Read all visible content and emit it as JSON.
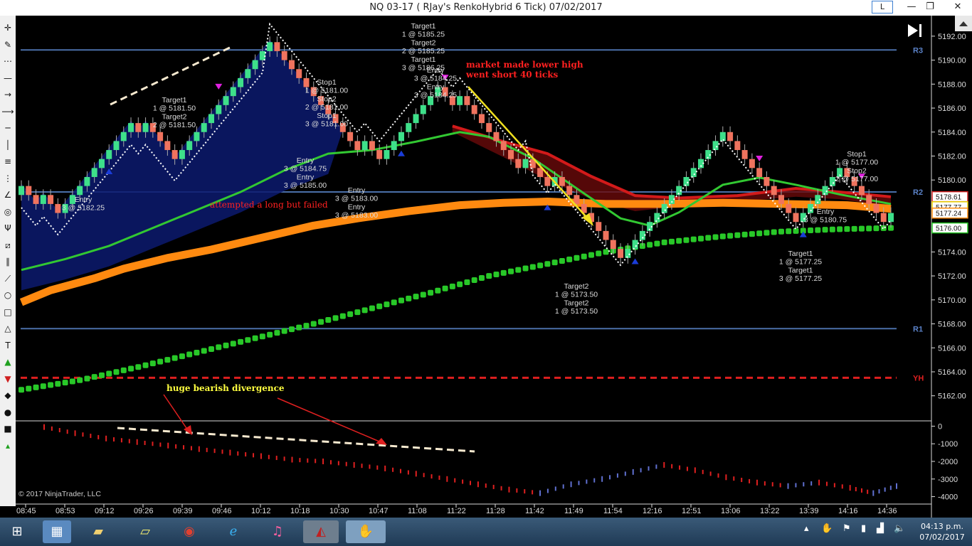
{
  "window": {
    "title": "NQ 03-17 ( RJay's RenkoHybrid  6 Tick)  07/02/2017",
    "l_button": "L",
    "minimize": "—",
    "restore": "❐",
    "close": "✕"
  },
  "toolbar": {
    "icons": [
      "crosshair-icon",
      "pencil-icon",
      "dots-icon",
      "line-icon",
      "ray-icon",
      "arrow-line-icon",
      "horizontal-line-icon",
      "vertical-line-icon",
      "channel-icon",
      "fib-icon",
      "gann-icon",
      "circle-target-icon",
      "pitchfork-icon",
      "regression-icon",
      "parallel-icon",
      "trend-icon",
      "ellipse-icon",
      "rectangle-icon",
      "triangle-icon",
      "text-icon",
      "arrow-up-icon",
      "arrow-down-icon",
      "diamond-icon",
      "dot-icon",
      "square-icon",
      "triangle-up-icon"
    ]
  },
  "chart_data": {
    "type": "candlestick",
    "price_axis": {
      "min": 5160.5,
      "max": 5193.0,
      "ticks": [
        "5192.00",
        "5190.00",
        "5188.00",
        "5186.00",
        "5184.00",
        "5182.00",
        "5180.00",
        "5178.00",
        "5176.00",
        "5174.00",
        "5172.00",
        "5170.00",
        "5168.00",
        "5166.00",
        "5164.00",
        "5162.00"
      ]
    },
    "price_boxes": [
      {
        "label": "5178.61",
        "value": 5178.61,
        "color": "#d02020"
      },
      {
        "label": "5177.77",
        "value": 5177.77,
        "color": "#e8d000"
      },
      {
        "label": "5177.24",
        "value": 5177.24,
        "color": "#ff8c10"
      },
      {
        "label": "5176.00",
        "value": 5176.0,
        "color": "#20c020"
      }
    ],
    "time_labels": [
      "08:45",
      "08:53",
      "09:12",
      "09:26",
      "09:39",
      "09:46",
      "10:12",
      "10:18",
      "10:30",
      "10:47",
      "11:08",
      "11:22",
      "11:28",
      "11:42",
      "11:49",
      "11:54",
      "12:16",
      "12:51",
      "13:06",
      "13:22",
      "13:39",
      "14:16",
      "14:36"
    ],
    "pivot_levels": [
      {
        "name": "R3",
        "value": 5190.85,
        "color": "#4a6fa8",
        "style": "solid"
      },
      {
        "name": "R2",
        "value": 5179.0,
        "color": "#4a6fa8",
        "style": "solid"
      },
      {
        "name": "R1",
        "value": 5167.6,
        "color": "#4a6fa8",
        "style": "solid"
      },
      {
        "name": "YH",
        "value": 5163.5,
        "color": "#dd1f1f",
        "style": "dashed"
      }
    ],
    "candles": [
      5179.5,
      5178.75,
      5178.0,
      5178.75,
      5178.0,
      5177.25,
      5178.0,
      5178.75,
      5179.5,
      5180.25,
      5181.0,
      5181.75,
      5182.5,
      5183.25,
      5184.0,
      5184.75,
      5184.0,
      5184.75,
      5184.0,
      5183.25,
      5182.5,
      5181.75,
      5182.5,
      5183.25,
      5184.0,
      5184.75,
      5185.5,
      5186.25,
      5187.0,
      5187.75,
      5188.5,
      5189.25,
      5190.0,
      5190.75,
      5191.5,
      5190.75,
      5190.0,
      5189.25,
      5188.5,
      5187.75,
      5187.0,
      5186.25,
      5185.5,
      5184.75,
      5184.0,
      5183.25,
      5182.5,
      5183.25,
      5182.5,
      5181.75,
      5182.5,
      5183.25,
      5184.0,
      5184.75,
      5185.5,
      5186.25,
      5187.0,
      5187.75,
      5187.0,
      5186.25,
      5187.0,
      5186.25,
      5185.5,
      5184.75,
      5184.0,
      5183.25,
      5182.5,
      5181.75,
      5181.0,
      5181.75,
      5181.0,
      5180.25,
      5179.5,
      5180.25,
      5179.5,
      5178.75,
      5178.0,
      5177.25,
      5176.5,
      5175.75,
      5175.0,
      5174.25,
      5173.5,
      5174.25,
      5175.0,
      5175.75,
      5176.5,
      5177.25,
      5178.0,
      5178.75,
      5179.5,
      5180.25,
      5181.0,
      5181.75,
      5182.5,
      5183.25,
      5184.0,
      5183.25,
      5182.5,
      5181.75,
      5181.0,
      5180.25,
      5179.5,
      5178.75,
      5178.0,
      5177.25,
      5176.5,
      5177.25,
      5178.0,
      5178.75,
      5179.5,
      5180.25,
      5181.0,
      5180.25,
      5179.5,
      5178.75,
      5178.0,
      5177.25,
      5176.5,
      5177.25
    ],
    "indicators": {
      "orange_line": [
        [
          0,
          5169.8
        ],
        [
          4,
          5170.8
        ],
        [
          10,
          5171.8
        ],
        [
          14,
          5172.6
        ],
        [
          20,
          5173.5
        ],
        [
          26,
          5174.2
        ],
        [
          33,
          5175.2
        ],
        [
          40,
          5176.2
        ],
        [
          46,
          5176.8
        ],
        [
          53,
          5177.4
        ],
        [
          60,
          5177.9
        ],
        [
          66,
          5178.1
        ],
        [
          72,
          5178.2
        ],
        [
          80,
          5178.0
        ],
        [
          88,
          5178.0
        ],
        [
          96,
          5178.1
        ],
        [
          104,
          5178.0
        ],
        [
          113,
          5177.9
        ],
        [
          119,
          5177.6
        ]
      ],
      "green_dots": [
        [
          0,
          5162.5
        ],
        [
          8,
          5163.3
        ],
        [
          16,
          5164.4
        ],
        [
          24,
          5165.6
        ],
        [
          32,
          5166.8
        ],
        [
          40,
          5168.0
        ],
        [
          48,
          5169.3
        ],
        [
          56,
          5170.6
        ],
        [
          64,
          5172.0
        ],
        [
          72,
          5173.0
        ],
        [
          80,
          5174.0
        ],
        [
          88,
          5174.8
        ],
        [
          96,
          5175.3
        ],
        [
          104,
          5175.7
        ],
        [
          112,
          5175.9
        ],
        [
          119,
          5176.0
        ]
      ],
      "green_line": [
        [
          0,
          5172.5
        ],
        [
          6,
          5173.4
        ],
        [
          12,
          5174.5
        ],
        [
          18,
          5176.0
        ],
        [
          24,
          5177.5
        ],
        [
          30,
          5179.0
        ],
        [
          36,
          5180.8
        ],
        [
          42,
          5182.2
        ],
        [
          48,
          5182.5
        ],
        [
          54,
          5183.2
        ],
        [
          60,
          5184.0
        ],
        [
          64,
          5183.6
        ],
        [
          70,
          5181.8
        ],
        [
          76,
          5179.3
        ],
        [
          82,
          5176.8
        ],
        [
          86,
          5176.2
        ],
        [
          90,
          5177.3
        ],
        [
          96,
          5179.6
        ],
        [
          101,
          5180.2
        ],
        [
          106,
          5179.6
        ],
        [
          112,
          5178.8
        ],
        [
          119,
          5178.0
        ]
      ],
      "red_band_top": [
        [
          59,
          5184.5
        ],
        [
          66,
          5183.2
        ],
        [
          72,
          5182.2
        ],
        [
          78,
          5180.3
        ],
        [
          84,
          5178.7
        ],
        [
          90,
          5178.5
        ],
        [
          98,
          5178.7
        ],
        [
          106,
          5179.3
        ],
        [
          112,
          5179.0
        ],
        [
          119,
          5178.6
        ]
      ],
      "red_band_bottom": [
        [
          59,
          5184.0
        ],
        [
          66,
          5181.9
        ],
        [
          72,
          5180.0
        ],
        [
          78,
          5178.4
        ],
        [
          84,
          5177.4
        ],
        [
          90,
          5177.8
        ],
        [
          98,
          5178.2
        ],
        [
          106,
          5178.6
        ],
        [
          112,
          5178.4
        ],
        [
          119,
          5177.8
        ]
      ]
    },
    "annotations": [
      {
        "text": "market made lower high",
        "color": "#ff2020",
        "bold": true
      },
      {
        "text": "went short 40 ticks",
        "color": "#ff2020",
        "bold": true
      },
      {
        "text": "attempted a long but failed",
        "color": "#ff2020",
        "bold": false
      },
      {
        "text": "huge bearish divergence",
        "color": "#ffff40",
        "bold": true
      }
    ],
    "trade_labels": [
      {
        "lines": [
          "Target1",
          "1 @ 5181.50",
          "Target2",
          "2 @ 5181.50"
        ]
      },
      {
        "lines": [
          "Entry",
          "3 @ 5182.25"
        ]
      },
      {
        "lines": [
          "Target1",
          "1 @ 5185.25",
          "Target2",
          "2 @ 5185.25",
          "Target1",
          "3 @ 5186.25"
        ]
      },
      {
        "lines": [
          "Stop1",
          "1 @ 5181.00",
          "Stop2",
          "2 @ 5181.00",
          "Stop1",
          "3 @ 5181.00"
        ]
      },
      {
        "lines": [
          "Entry",
          "3 @ 5184.25",
          "Entry",
          "3 @ 5184.25"
        ]
      },
      {
        "lines": [
          "Entry",
          "3 @ 5184.75",
          "Entry",
          "3 @ 5185.00"
        ]
      },
      {
        "lines": [
          "Entry",
          "3 @ 5183.00",
          "Entry",
          "3 @ 5183.00"
        ]
      },
      {
        "lines": [
          "Target2",
          "1 @ 5173.50",
          "Target2",
          "1 @ 5173.50"
        ]
      },
      {
        "lines": [
          "Stop1",
          "1 @ 5177.00",
          "Stop2",
          "2 @ 5177.00"
        ]
      },
      {
        "lines": [
          "Entry",
          "3 @ 5180.75"
        ]
      },
      {
        "lines": [
          "Target1",
          "1 @ 5177.25",
          "Target1",
          "3 @ 5177.25"
        ]
      }
    ],
    "oscillator": {
      "ticks": [
        "0",
        "-1000",
        "-2000",
        "-3000",
        "-4000"
      ],
      "min": -4300,
      "max": 300,
      "points": [
        [
          0,
          -50
        ],
        [
          8,
          -400
        ],
        [
          16,
          -700
        ],
        [
          24,
          -900
        ],
        [
          32,
          -1100
        ],
        [
          40,
          -1300
        ],
        [
          48,
          -1500
        ],
        [
          56,
          -1700
        ],
        [
          64,
          -1900
        ],
        [
          72,
          -2000
        ],
        [
          80,
          -2200
        ],
        [
          88,
          -2400
        ],
        [
          96,
          -2700
        ],
        [
          104,
          -3000
        ],
        [
          112,
          -3300
        ],
        [
          120,
          -3600
        ],
        [
          128,
          -3800
        ],
        [
          136,
          -3300
        ],
        [
          144,
          -3000
        ],
        [
          152,
          -2600
        ],
        [
          160,
          -2200
        ],
        [
          168,
          -2500
        ],
        [
          176,
          -2900
        ],
        [
          184,
          -3200
        ],
        [
          192,
          -3400
        ],
        [
          200,
          -3200
        ],
        [
          208,
          -3500
        ],
        [
          214,
          -3800
        ],
        [
          220,
          -3400
        ]
      ]
    },
    "copyright": "© 2017 NinjaTrader, LLC"
  },
  "taskbar": {
    "apps": [
      "windows-start-icon",
      "calculator-icon",
      "file-explorer-icon",
      "sticky-notes-icon",
      "chrome-icon",
      "internet-explorer-icon",
      "itunes-icon",
      "ninjatrader-icon",
      "hand-tool-icon"
    ],
    "time": "04:13 p.m.",
    "date": "07/02/2017"
  }
}
